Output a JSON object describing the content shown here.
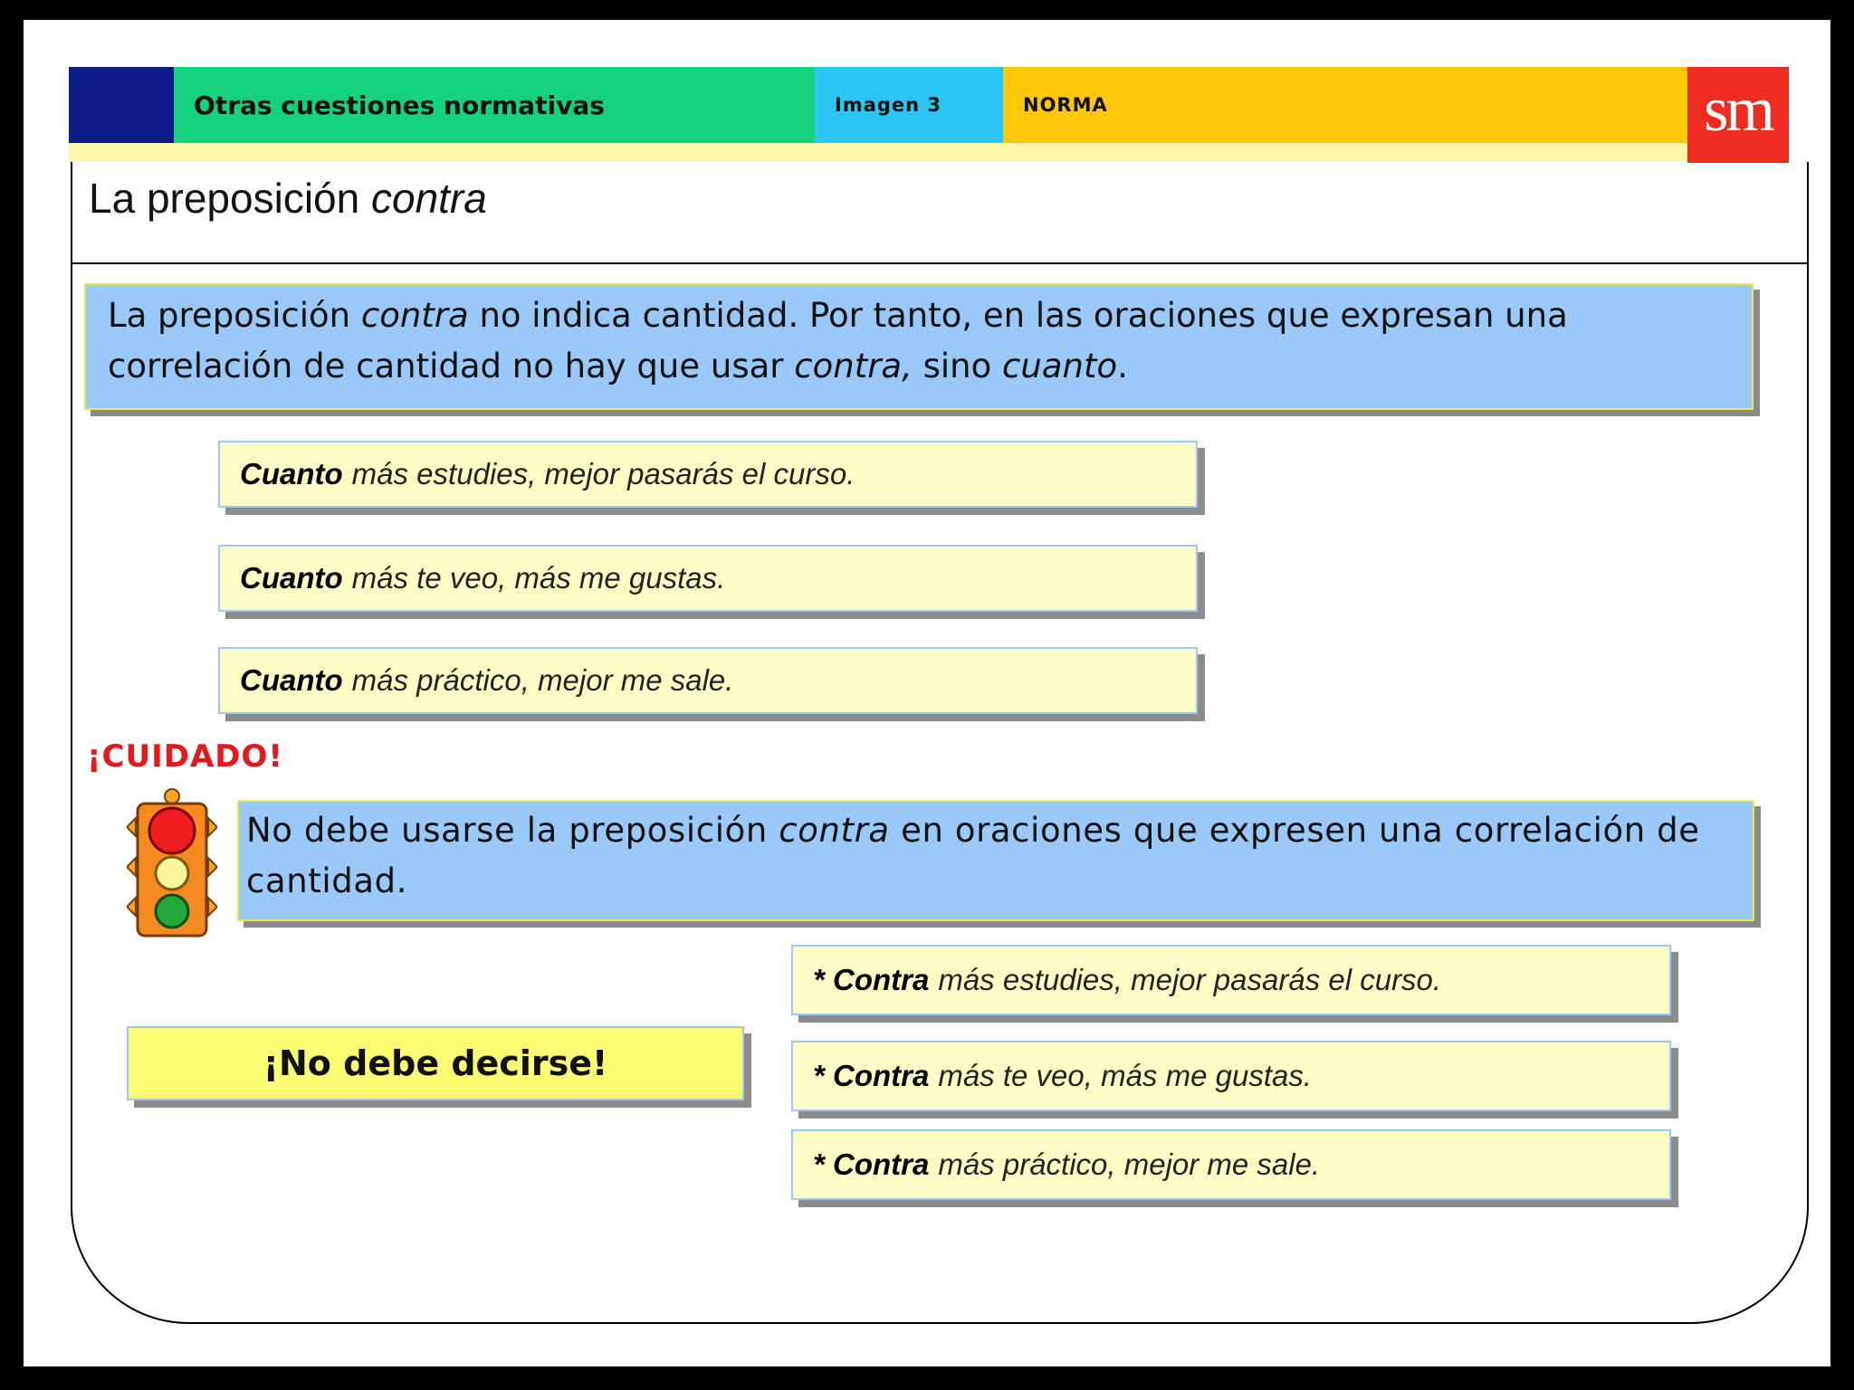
{
  "header": {
    "section": "Otras cuestiones normativas",
    "image_label": "Imagen 3",
    "category": "NORMA",
    "logo": "sm"
  },
  "title": {
    "text": "La preposición ",
    "italic": "contra"
  },
  "rule": {
    "t1": "La preposición ",
    "i1": "contra",
    "t2": " no indica cantidad. Por tanto, en las oraciones que expresan una correlación de cantidad no hay que usar ",
    "i2": "contra,",
    "t3": " sino ",
    "i3": "cuanto",
    "t4": "."
  },
  "correct_examples": [
    {
      "bold": "Cuanto",
      "rest": "más estudies, mejor pasarás el curso."
    },
    {
      "bold": "Cuanto",
      "rest": "más te veo, más me gustas."
    },
    {
      "bold": "Cuanto",
      "rest": "más práctico, mejor me sale."
    }
  ],
  "warning": {
    "label": "¡CUIDADO!",
    "t1": "No debe usarse la preposición ",
    "i1": "contra",
    "t2": " en oraciones que expresen una  correlación de cantidad.",
    "icon": "traffic-light-icon"
  },
  "incorrect_label": "¡No debe decirse!",
  "incorrect_examples": [
    {
      "bold": "* Contra",
      "rest": "más estudies, mejor pasarás el curso."
    },
    {
      "bold": "* Contra",
      "rest": "más te veo, más me gustas."
    },
    {
      "bold": "* Contra",
      "rest": "más práctico, mejor me sale."
    }
  ],
  "colors": {
    "navy": "#0d1a8a",
    "green": "#15d27c",
    "cyan": "#2cc6f4",
    "yellow": "#fdc80a",
    "logo_red": "#ef2c22",
    "panel_blue": "#99c8f9",
    "example_yellow": "#fdfdc5",
    "warning_red": "#e5191c"
  }
}
